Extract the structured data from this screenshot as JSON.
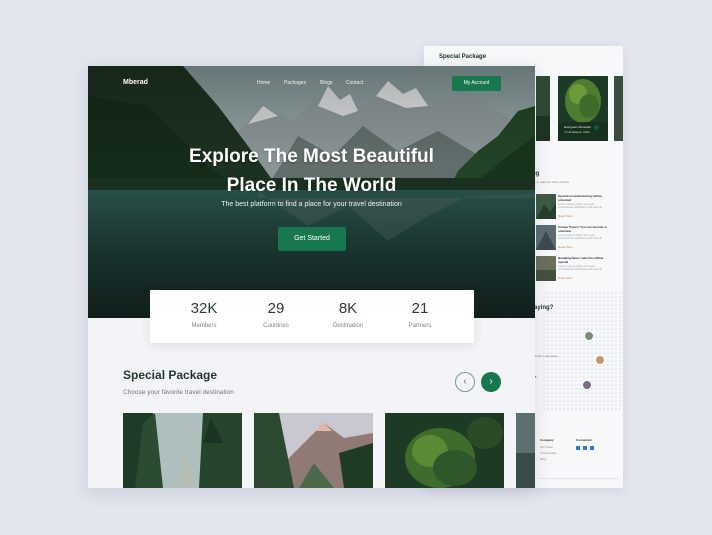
{
  "back_page": {
    "header_title": "Special Package",
    "prev_icon": "chevron-left-icon",
    "next_icon": "chevron-right-icon",
    "card": {
      "title": "Evergreen Mountain",
      "subtitle": "⊙ Himalayas, India"
    },
    "blog_title": "og",
    "blog_subtitle": "ws to read our other articles",
    "blogs": [
      {
        "title": "Special mountaineering will be unlocked",
        "text": "Lorem ipsum dolor sit amet, consectetur adipiscing elit sed do",
        "more": "Read More"
      },
      {
        "title": "Unique Travel ! You can become a volunteer",
        "text": "Lorem ipsum dolor sit amet, consectetur adipiscing elit sed do",
        "more": "Read More"
      },
      {
        "title": "Breaking News: take this offline special",
        "text": "Lorem ipsum dolor sit amet, consectetur adipiscing elit sed do",
        "more": "Read More"
      }
    ],
    "testimonial_title": "aying?",
    "testimonial_text": "ience! I can make",
    "testimonial_label": "h",
    "footer": {
      "company_title": "Company",
      "company_links": [
        "Our Team",
        "Testimonials",
        "Blog"
      ],
      "connect_title": "Connected"
    }
  },
  "nav": {
    "logo": "Mberad",
    "links": [
      "Home",
      "Packages",
      "Blogs",
      "Contact"
    ],
    "account_button": "My Account"
  },
  "hero": {
    "title_line1": "Explore The Most Beautiful",
    "title_line2": "Place In The World",
    "subtitle": "The best platform to find a place for your travel destination",
    "cta": "Get Started"
  },
  "stats": [
    {
      "value": "32K",
      "label": "Members"
    },
    {
      "value": "29",
      "label": "Countries"
    },
    {
      "value": "8K",
      "label": "Destination"
    },
    {
      "value": "21",
      "label": "Partners"
    }
  ],
  "packages": {
    "title": "Special Package",
    "subtitle": "Choose your favorite travel destination",
    "prev_icon": "chevron-left-icon",
    "next_icon": "chevron-right-icon",
    "prev_glyph": "‹",
    "next_glyph": "›"
  },
  "colors": {
    "brand_green": "#17774f",
    "page_bg": "#e3e6ef",
    "text_dark": "#23372d"
  }
}
